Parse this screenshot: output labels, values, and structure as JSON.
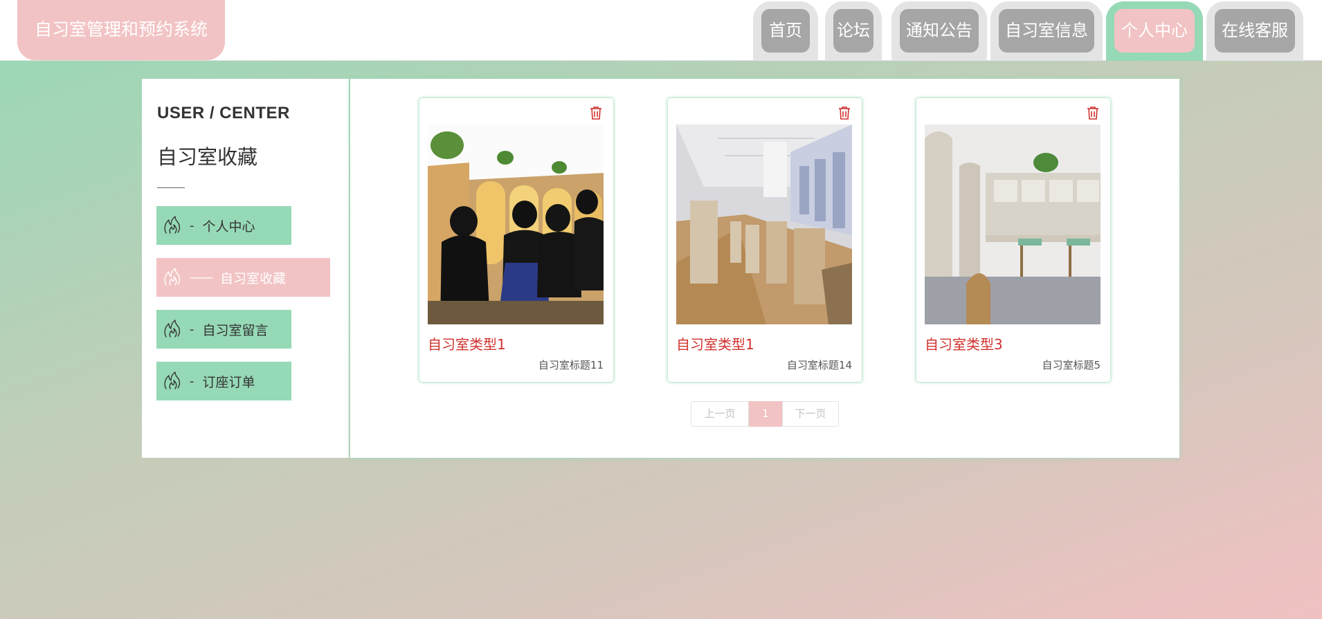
{
  "header": {
    "brand": "自习室管理和预约系统",
    "nav": [
      {
        "label": "首页",
        "active": false
      },
      {
        "label": "论坛",
        "active": false
      },
      {
        "label": "通知公告",
        "active": false
      },
      {
        "label": "自习室信息",
        "active": false
      },
      {
        "label": "个人中心",
        "active": true
      },
      {
        "label": "在线客服",
        "active": false
      }
    ]
  },
  "sidebar": {
    "title": "USER / CENTER",
    "subtitle": "自习室收藏",
    "items": [
      {
        "label": "个人中心",
        "dash": "-",
        "active": false,
        "icon": "flame-icon"
      },
      {
        "label": "自习室收藏",
        "dash": "——",
        "active": true,
        "icon": "flame-icon"
      },
      {
        "label": "自习室留言",
        "dash": "-",
        "active": false,
        "icon": "flame-icon"
      },
      {
        "label": "订座订单",
        "dash": "-",
        "active": false,
        "icon": "flame-icon"
      }
    ]
  },
  "cards": [
    {
      "type": "自习室类型1",
      "title": "自习室标题11",
      "delete_icon": "trash-icon"
    },
    {
      "type": "自习室类型1",
      "title": "自习室标题14",
      "delete_icon": "trash-icon"
    },
    {
      "type": "自习室类型3",
      "title": "自习室标题5",
      "delete_icon": "trash-icon"
    }
  ],
  "pagination": {
    "prev": "上一页",
    "current": "1",
    "next": "下一页"
  },
  "colors": {
    "accent_green": "#96d9b6",
    "accent_pink": "#f2c3c4",
    "nav_inactive": "#a6a6a6",
    "card_type_red": "#d0312d"
  }
}
